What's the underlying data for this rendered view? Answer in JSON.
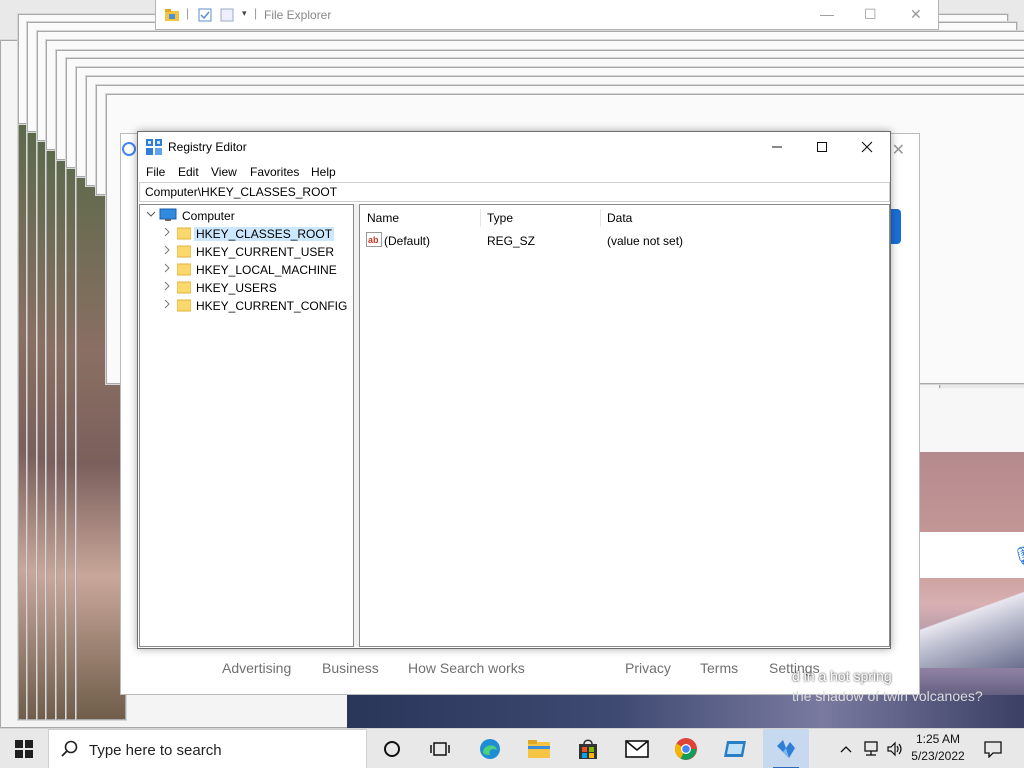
{
  "background": {
    "file_explorer": {
      "title": "File Explorer"
    },
    "browser_footer": {
      "links": [
        "Advertising",
        "Business",
        "How Search works",
        "Privacy",
        "Terms",
        "Settings"
      ]
    },
    "promo": {
      "line1": "d in a hot spring",
      "line2": "the shadow of twin volcanoes?"
    }
  },
  "regedit": {
    "title": "Registry Editor",
    "menu": [
      "File",
      "Edit",
      "View",
      "Favorites",
      "Help"
    ],
    "address": "Computer\\HKEY_CLASSES_ROOT",
    "tree": {
      "root": "Computer",
      "children": [
        {
          "label": "HKEY_CLASSES_ROOT",
          "selected": true
        },
        {
          "label": "HKEY_CURRENT_USER",
          "selected": false
        },
        {
          "label": "HKEY_LOCAL_MACHINE",
          "selected": false
        },
        {
          "label": "HKEY_USERS",
          "selected": false
        },
        {
          "label": "HKEY_CURRENT_CONFIG",
          "selected": false
        }
      ]
    },
    "columns": [
      "Name",
      "Type",
      "Data"
    ],
    "values": [
      {
        "name": "(Default)",
        "type": "REG_SZ",
        "data": "(value not set)"
      }
    ]
  },
  "taskbar": {
    "search_placeholder": "Type here to search",
    "apps": [
      "task-view",
      "edge",
      "file-explorer",
      "microsoft-store",
      "mail",
      "chrome",
      "remote-desktop",
      "registry-editor"
    ],
    "clock": {
      "time": "1:25 AM",
      "date": "5/23/2022"
    }
  },
  "colors": {
    "selection": "#cce8ff",
    "accent": "#1a6fd8"
  }
}
